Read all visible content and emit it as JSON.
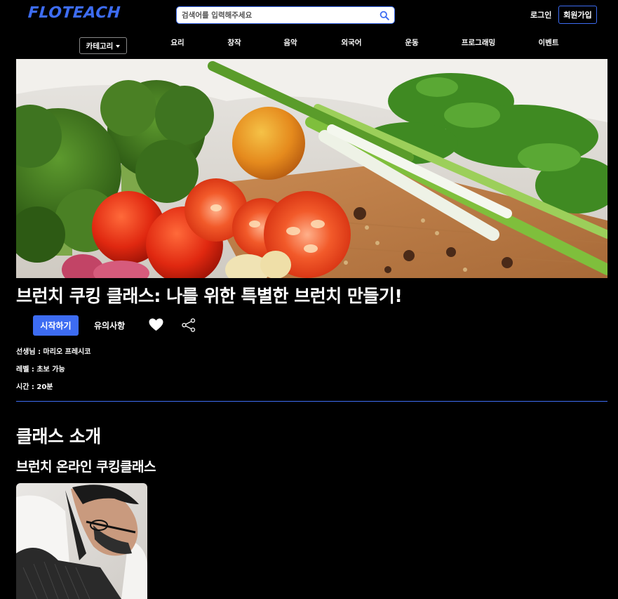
{
  "header": {
    "logo": "FLOTEACH",
    "search": {
      "placeholder": "검색어를 입력해주세요",
      "value": ""
    },
    "login": "로그인",
    "signup": "회원가입"
  },
  "nav": {
    "category": "카테고리",
    "items": [
      "요리",
      "창작",
      "음악",
      "외국어",
      "운동",
      "프로그래밍",
      "이벤트"
    ]
  },
  "class": {
    "title": "브런치 쿠킹 클래스: 나를 위한 특별한 브런치 만들기!",
    "start_button": "시작하기",
    "notice": "유의사항",
    "teacher": "선생님 : 마리오 프레시코",
    "level": "레벨 : 초보 가능",
    "time": "시간 : 20분"
  },
  "intro": {
    "heading": "클래스 소개",
    "subheading": "브런치 온라인 쿠킹클래스"
  },
  "colors": {
    "accent": "#3d6cf2",
    "background": "#000000",
    "text": "#ffffff"
  },
  "icons": [
    "search-icon",
    "caret-down-icon",
    "heart-icon",
    "share-icon"
  ]
}
